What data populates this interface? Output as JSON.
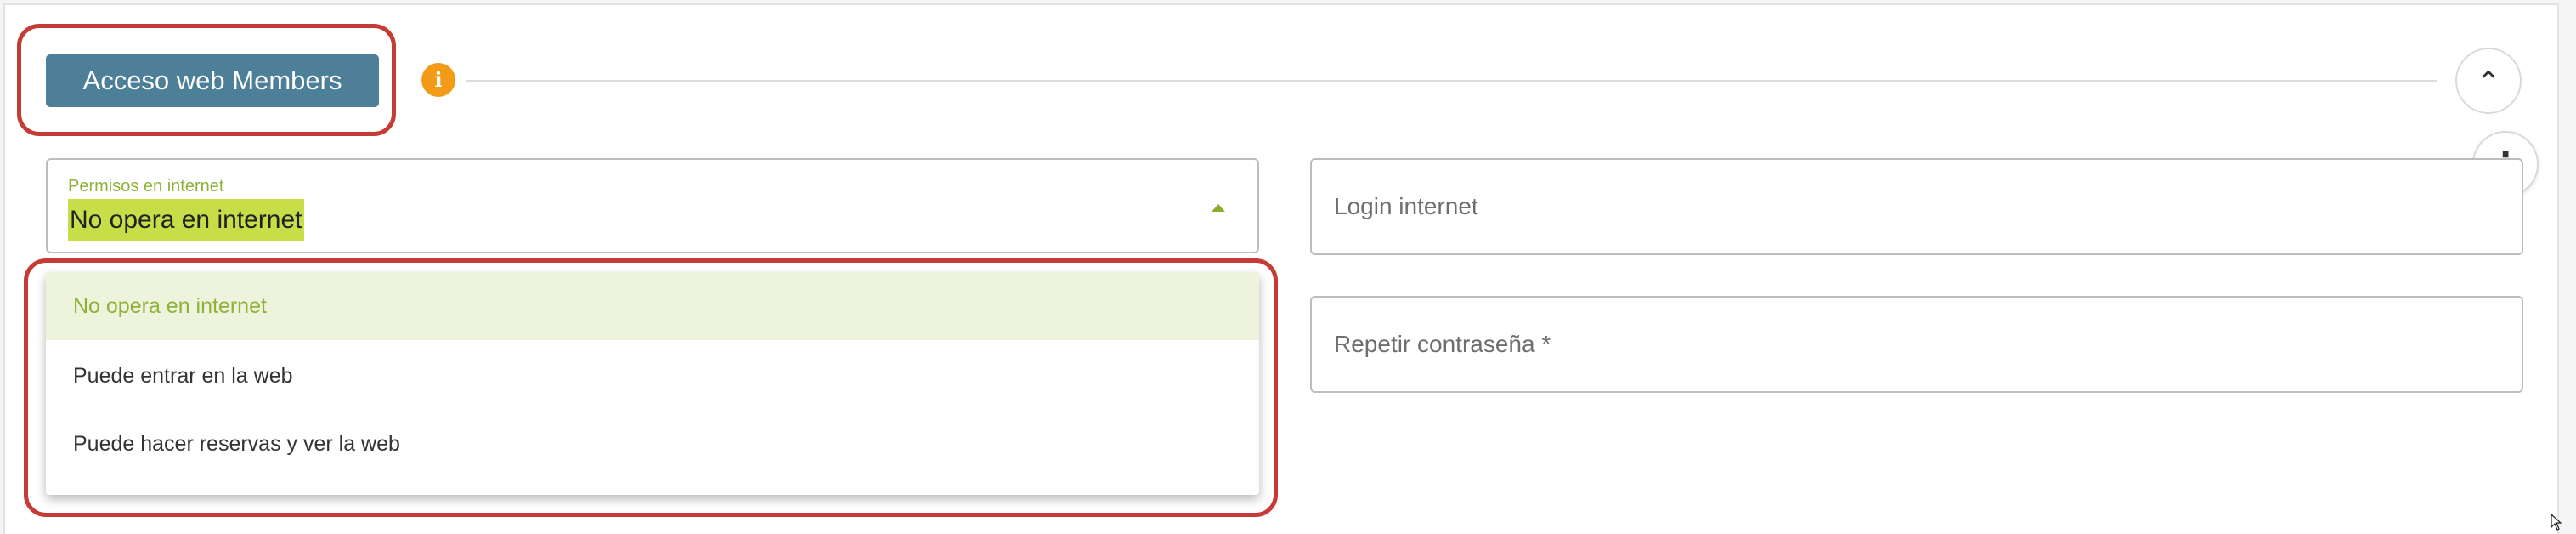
{
  "section": {
    "title": "Acceso web Members",
    "info_icon": "info-icon",
    "collapse_icon": "chevron-up-icon",
    "more_icon": "more-vertical-icon"
  },
  "permissions_select": {
    "label": "Permisos en internet",
    "value": "No opera en internet",
    "options": [
      {
        "label": "No opera en internet",
        "selected": true
      },
      {
        "label": "Puede entrar en la web",
        "selected": false
      },
      {
        "label": "Puede hacer reservas y ver la web",
        "selected": false
      }
    ]
  },
  "login_field": {
    "placeholder": "Login internet"
  },
  "password_field": {
    "placeholder": "Repetir contraseña *"
  },
  "colors": {
    "section_button": "#4d7f99",
    "info": "#f39a17",
    "accent_green": "#8fb13a",
    "highlight": "#c7de49",
    "annotation_red": "#c53b36"
  }
}
